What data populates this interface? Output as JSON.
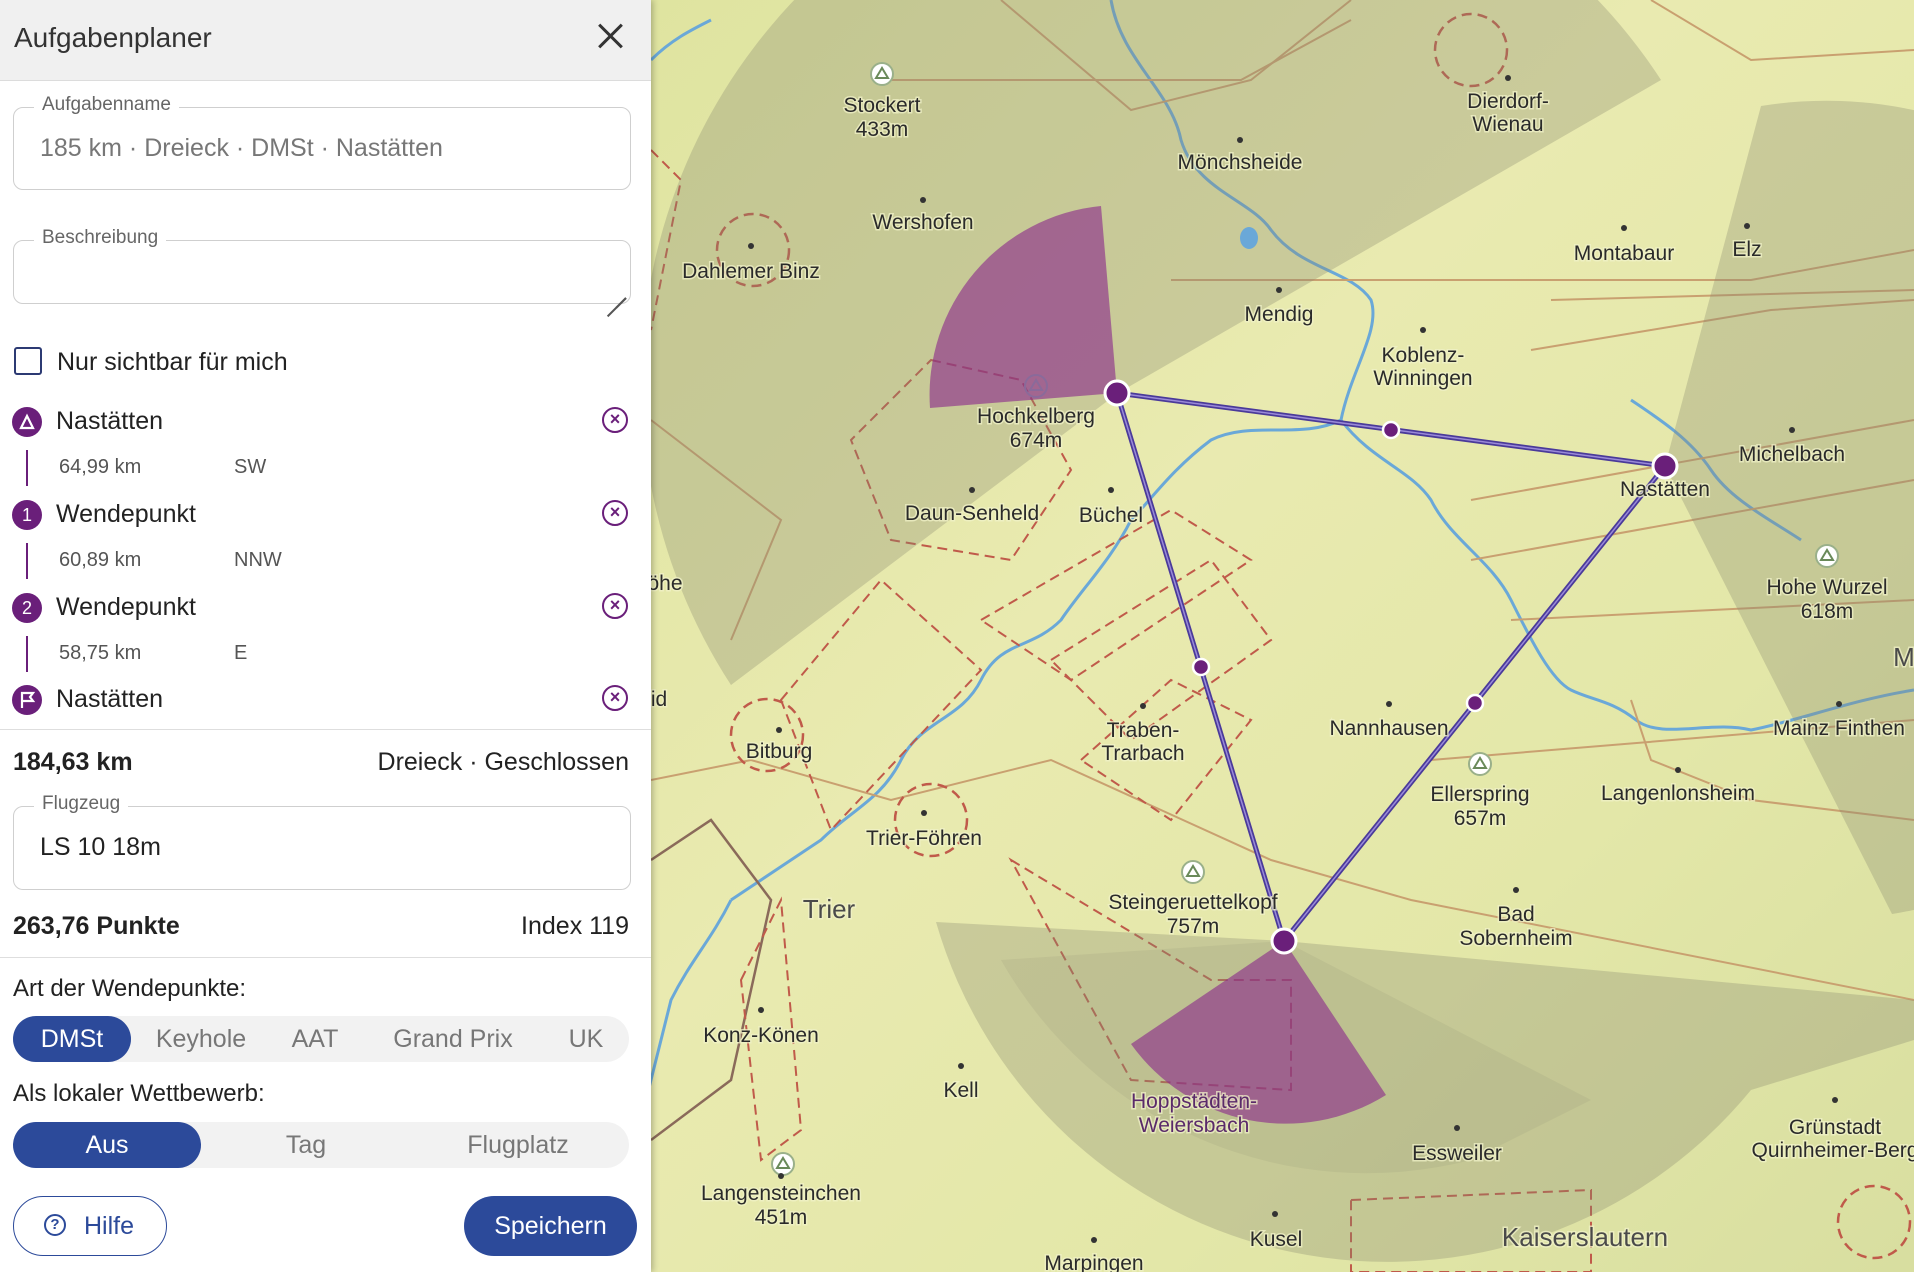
{
  "panel": {
    "title": "Aufgabenplaner",
    "task_name": {
      "legend": "Aufgabenname",
      "value": "185 km · Dreieck · DMSt · Nastätten"
    },
    "description": {
      "legend": "Beschreibung",
      "value": ""
    },
    "private_checkbox": {
      "label": "Nur sichtbar für mich",
      "checked": false
    },
    "waypoints": [
      {
        "badge": "start-icon",
        "name": "Nastätten",
        "leg_distance": "64,99 km",
        "leg_direction": "SW"
      },
      {
        "badge": "1",
        "name": "Wendepunkt",
        "leg_distance": "60,89 km",
        "leg_direction": "NNW"
      },
      {
        "badge": "2",
        "name": "Wendepunkt",
        "leg_distance": "58,75 km",
        "leg_direction": "E"
      },
      {
        "badge": "finish-flag-icon",
        "name": "Nastätten"
      }
    ],
    "summary": {
      "distance": "184,63 km",
      "type": "Dreieck · Geschlossen"
    },
    "aircraft": {
      "legend": "Flugzeug",
      "value": "LS 10 18m"
    },
    "score": {
      "points": "263,76 Punkte",
      "index": "Index 119"
    },
    "turnpoint_type": {
      "label": "Art der Wendepunkte:",
      "options": [
        "DMSt",
        "Keyhole",
        "AAT",
        "Grand Prix",
        "UK"
      ],
      "selected": "DMSt"
    },
    "local_competition": {
      "label": "Als lokaler Wettbewerb:",
      "options": [
        "Aus",
        "Tag",
        "Flugplatz"
      ],
      "selected": "Aus"
    },
    "help_button": "Hilfe",
    "save_button": "Speichern"
  },
  "map": {
    "accent_color": "#6a1f7a",
    "labels": {
      "stockert": "Stockert",
      "stockert_elev": "433m",
      "dierdorf1": "Dierdorf-",
      "dierdorf2": "Wienau",
      "moenchsheide": "Mönchsheide",
      "wershofen": "Wershofen",
      "dahlemer": "Dahlemer Binz",
      "montabaur": "Montabaur",
      "elz": "Elz",
      "mendig": "Mendig",
      "koblenz1": "Koblenz-",
      "koblenz2": "Winningen",
      "hochkelberg": "Hochkelberg",
      "hochkelberg_elev": "674m",
      "michelbach": "Michelbach",
      "nastaetten": "Nastätten",
      "daun": "Daun-Senheld",
      "buechel": "Büchel",
      "hohe_wurzel": "Hohe Wurzel",
      "hohe_wurzel_elev": "618m",
      "ohe": "öhe",
      "id": "id",
      "traben1": "Traben-",
      "traben2": "Trarbach",
      "nannhausen": "Nannhausen",
      "mainz": "Mainz Finthen",
      "m": "M",
      "bitburg": "Bitburg",
      "ellerspring": "Ellerspring",
      "ellerspring_elev": "657m",
      "langenlonsheim": "Langenlonsheim",
      "trier_foehren": "Trier-Föhren",
      "trier": "Trier",
      "steinger": "Steingeruettelkopf",
      "steinger_elev": "757m",
      "bad1": "Bad",
      "bad2": "Sobernheim",
      "konz": "Konz-Könen",
      "kell": "Kell",
      "hopp1": "Hoppstädten-",
      "hopp2": "Weiersbach",
      "gruenstadt1": "Grünstadt",
      "gruenstadt2": "Quirnheimer-Berg",
      "esweiler": "Essweiler",
      "langenst": "Langensteinchen",
      "langenst_elev": "451m",
      "kaiserslautern": "Kaiserslautern",
      "kusel": "Kusel",
      "marpingen": "Marpingen"
    }
  }
}
